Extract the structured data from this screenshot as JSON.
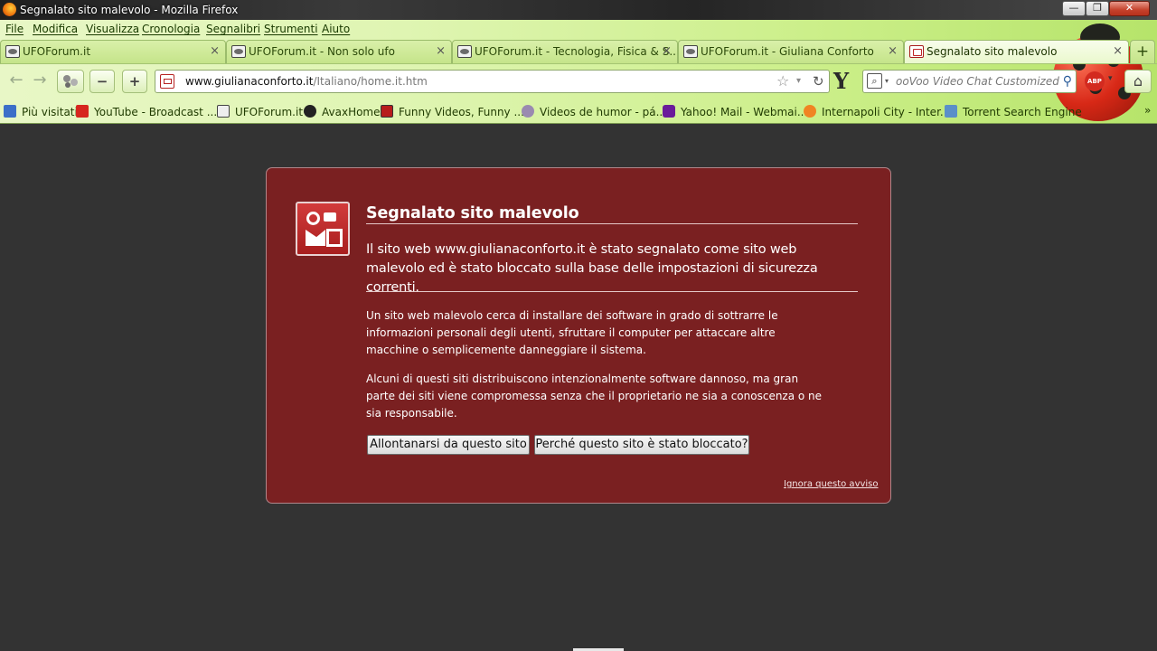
{
  "window": {
    "title": "Segnalato sito malevolo - Mozilla Firefox",
    "controls": {
      "minimize": "—",
      "maximize": "❐",
      "close": "✕"
    }
  },
  "menu": [
    "File",
    "Modifica",
    "Visualizza",
    "Cronologia",
    "Segnalibri",
    "Strumenti",
    "Aiuto"
  ],
  "tabs": [
    {
      "title": "UFOForum.it",
      "close": "×"
    },
    {
      "title": "UFOForum.it - Non solo ufo",
      "close": "×"
    },
    {
      "title": "UFOForum.it - Tecnologia, Fisica & S...",
      "close": "×"
    },
    {
      "title": "UFOForum.it - Giuliana Conforto",
      "close": "×"
    },
    {
      "title": "Segnalato sito malevolo",
      "close": "×",
      "active": true
    }
  ],
  "new_tab_label": "+",
  "nav": {
    "back": "←",
    "forward": "→",
    "zoom_out": "−",
    "zoom_in": "+",
    "url_domain": "www.giulianaconforto.it",
    "url_path": "/Italiano/home.it.htm",
    "star": "☆",
    "dropdown": "▾",
    "reload": "↻",
    "yahoo": "Y",
    "search_engine": "⌕",
    "search_placeholder": "ooVoo Video Chat Customized We",
    "search_go": "⚲",
    "abp": "ABP",
    "home": "⌂"
  },
  "bookmarks": [
    {
      "label": "Più visitati",
      "icon": "visited"
    },
    {
      "label": "YouTube - Broadcast ...",
      "icon": "youtube"
    },
    {
      "label": "UFOForum.it",
      "icon": "ufo"
    },
    {
      "label": "AvaxHome",
      "icon": "avax"
    },
    {
      "label": "Funny Videos, Funny ...",
      "icon": "funny"
    },
    {
      "label": "Videos de humor - pá...",
      "icon": "humor"
    },
    {
      "label": "Yahoo! Mail - Webmai...",
      "icon": "yahoo"
    },
    {
      "label": "Internapoli City - Inter...",
      "icon": "internapoli"
    },
    {
      "label": "Torrent Search Engine",
      "icon": "torrent"
    }
  ],
  "bookmarks_more": "»",
  "warning": {
    "title": "Segnalato sito malevolo",
    "lead": "Il sito web www.giulianaconforto.it è stato segnalato come sito web malevolo ed è stato bloccato sulla base delle impostazioni di sicurezza correnti.",
    "paragraph_1": "Un sito web malevolo cerca di installare dei software in grado di sottrarre le informazioni personali degli utenti, sfruttare il computer per attaccare altre macchine o semplicemente danneggiare il sistema.",
    "paragraph_2": "Alcuni di questi siti distribuiscono intenzionalmente software dannoso, ma gran parte dei siti viene compromessa senza che il proprietario ne sia a conoscenza o ne sia responsabile.",
    "get_out_button": "Allontanarsi da questo sito",
    "why_button": "Perché questo sito è stato bloccato?",
    "ignore_link": "Ignora questo avviso"
  },
  "colors": {
    "warning_background": "#7a2021",
    "page_background": "#333333",
    "chrome_green": "#ccef8a"
  }
}
